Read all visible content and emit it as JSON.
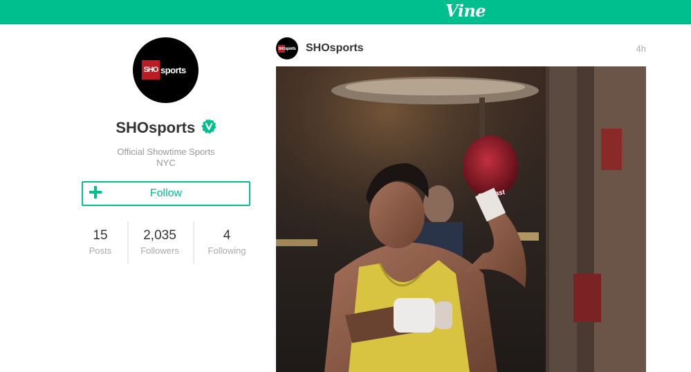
{
  "header": {
    "logo_text": "Vine",
    "background_color": "#00bf8f"
  },
  "profile": {
    "avatar_logo_sho": "SHO",
    "avatar_logo_sports": "sports",
    "name": "SHOsports",
    "verified_icon": "verified-badge-icon",
    "bio_line1": "Official Showtime Sports",
    "bio_line2": "NYC",
    "follow_label": "Follow",
    "stats": [
      {
        "value": "15",
        "label": "Posts"
      },
      {
        "value": "2,035",
        "label": "Followers"
      },
      {
        "value": "4",
        "label": "Following"
      }
    ]
  },
  "post": {
    "avatar_logo_sho": "SHO",
    "avatar_logo_sports": "sports",
    "username": "SHOsports",
    "time_ago": "4h",
    "video_text": "Everlast"
  },
  "colors": {
    "accent": "#00bf8f",
    "sho_red": "#b91c23",
    "text_dark": "#333333",
    "text_muted": "#aaaaaa"
  }
}
